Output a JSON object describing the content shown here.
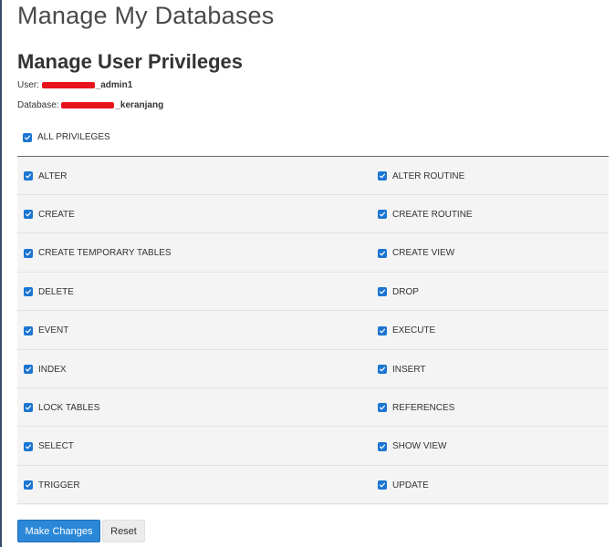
{
  "page": {
    "title": "Manage My Databases"
  },
  "section": {
    "title": "Manage User Privileges"
  },
  "meta": {
    "user_label": "User:",
    "user_value_suffix": "_admin1",
    "database_label": "Database:",
    "database_value_suffix": "_keranjang"
  },
  "all_privileges": {
    "label": "ALL PRIVILEGES",
    "checked": true
  },
  "privileges": [
    {
      "left": "ALTER",
      "right": "ALTER ROUTINE"
    },
    {
      "left": "CREATE",
      "right": "CREATE ROUTINE"
    },
    {
      "left": "CREATE TEMPORARY TABLES",
      "right": "CREATE VIEW"
    },
    {
      "left": "DELETE",
      "right": "DROP"
    },
    {
      "left": "EVENT",
      "right": "EXECUTE"
    },
    {
      "left": "INDEX",
      "right": "INSERT"
    },
    {
      "left": "LOCK TABLES",
      "right": "REFERENCES"
    },
    {
      "left": "SELECT",
      "right": "SHOW VIEW"
    },
    {
      "left": "TRIGGER",
      "right": "UPDATE"
    }
  ],
  "buttons": {
    "make_changes": "Make Changes",
    "reset": "Reset"
  },
  "colors": {
    "checkbox": "#1b75d2",
    "primary_button": "#2b88d8",
    "redaction": "#e8121c"
  }
}
